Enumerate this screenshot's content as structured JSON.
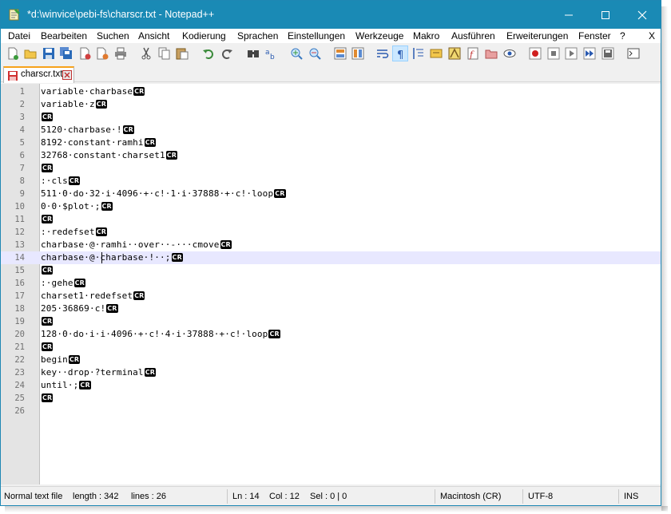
{
  "window": {
    "title": "*d:\\winvice\\pebi-fs\\charscr.txt - Notepad++"
  },
  "menu": {
    "items": [
      "Datei",
      "Bearbeiten",
      "Suchen",
      "Ansicht",
      "Kodierung",
      "Sprachen",
      "Einstellungen",
      "Werkzeuge",
      "Makro",
      "Ausführen",
      "Erweiterungen",
      "Fenster",
      "?"
    ],
    "close_label": "X"
  },
  "toolbar": {
    "icons": [
      "new-file-icon",
      "open-file-icon",
      "save-icon",
      "save-all-icon",
      "close-icon",
      "close-all-icon",
      "print-icon",
      "cut-icon",
      "copy-icon",
      "paste-icon",
      "undo-icon",
      "redo-icon",
      "find-icon",
      "replace-icon",
      "zoom-in-icon",
      "zoom-out-icon",
      "sync-vertical-icon",
      "sync-horizontal-icon",
      "word-wrap-icon",
      "show-all-characters-icon",
      "indent-guide-icon",
      "user-language-icon",
      "document-map-icon",
      "function-list-icon",
      "folder-workspace-icon",
      "monitoring-icon",
      "record-macro-icon",
      "stop-macro-icon",
      "play-macro-icon",
      "run-macro-multiple-icon",
      "save-macro-icon",
      "console-icon"
    ]
  },
  "tab": {
    "label": "charscr.txt"
  },
  "editor": {
    "eol_marker": "CR",
    "current_line": 14,
    "lines": [
      {
        "num": "1",
        "text": "variable·charbase",
        "eol": true
      },
      {
        "num": "2",
        "text": "variable·z",
        "eol": true
      },
      {
        "num": "3",
        "text": "",
        "eol": true
      },
      {
        "num": "4",
        "text": "5120·charbase·!",
        "eol": true
      },
      {
        "num": "5",
        "text": "8192·constant·ramhi",
        "eol": true
      },
      {
        "num": "6",
        "text": "32768·constant·charset1",
        "eol": true
      },
      {
        "num": "7",
        "text": "",
        "eol": true
      },
      {
        "num": "8",
        "text": ":·cls",
        "eol": true
      },
      {
        "num": "9",
        "text": "511·0·do·32·i·4096·+·c!·1·i·37888·+·c!·loop",
        "eol": true
      },
      {
        "num": "10",
        "text": "0·0·$plot·;",
        "eol": true
      },
      {
        "num": "11",
        "text": "",
        "eol": true
      },
      {
        "num": "12",
        "text": ":·redefset",
        "eol": true
      },
      {
        "num": "13",
        "text": "charbase·@·ramhi··over··-···cmove",
        "eol": true
      },
      {
        "num": "14",
        "text": "charbase·@·charbase·!··;",
        "eol": true
      },
      {
        "num": "15",
        "text": "",
        "eol": true
      },
      {
        "num": "16",
        "text": ":·gehe",
        "eol": true
      },
      {
        "num": "17",
        "text": "charset1·redefset",
        "eol": true
      },
      {
        "num": "18",
        "text": "205·36869·c!",
        "eol": true
      },
      {
        "num": "19",
        "text": "",
        "eol": true
      },
      {
        "num": "20",
        "text": "128·0·do·i·i·4096·+·c!·4·i·37888·+·c!·loop",
        "eol": true
      },
      {
        "num": "21",
        "text": "",
        "eol": true
      },
      {
        "num": "22",
        "text": "begin",
        "eol": true
      },
      {
        "num": "23",
        "text": "key··drop·?terminal",
        "eol": true
      },
      {
        "num": "24",
        "text": "until·;",
        "eol": true
      },
      {
        "num": "25",
        "text": "",
        "eol": true
      },
      {
        "num": "26",
        "text": "",
        "eol": false
      }
    ]
  },
  "statusbar": {
    "file_type": "Normal text file",
    "length": "length : 342",
    "lines": "lines : 26",
    "line": "Ln : 14",
    "column": "Col : 12",
    "selection": "Sel : 0 | 0",
    "eol_format": "Macintosh (CR)",
    "encoding": "UTF-8",
    "insert_mode": "INS"
  }
}
